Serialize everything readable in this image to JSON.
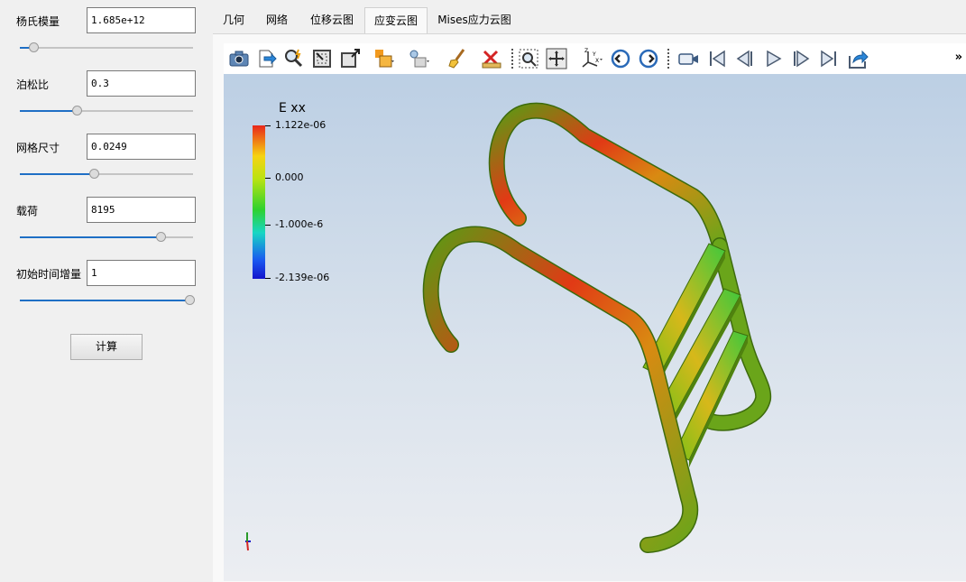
{
  "params": [
    {
      "label": "杨氏模量",
      "value": "1.685e+12",
      "slider": 0.07
    },
    {
      "label": "泊松比",
      "value": "0.3",
      "slider": 0.33
    },
    {
      "label": "网格尺寸",
      "value": "0.0249",
      "slider": 0.43
    },
    {
      "label": "载荷",
      "value": "8195",
      "slider": 0.83
    },
    {
      "label": "初始时间增量",
      "value": "1",
      "slider": 1.0
    }
  ],
  "compute_label": "计算",
  "tabs": [
    {
      "label": "几何",
      "active": false
    },
    {
      "label": "网络",
      "active": false
    },
    {
      "label": "位移云图",
      "active": false
    },
    {
      "label": "应变云图",
      "active": true
    },
    {
      "label": "Mises应力云图",
      "active": false
    }
  ],
  "toolbar": {
    "icons": [
      "camera-icon",
      "export-icon",
      "probe-icon",
      "select-cells-icon",
      "select-points-icon",
      "representation-icon",
      "light-kit-icon",
      "clean-brush-icon",
      "ruler-icon",
      "zoom-box-icon",
      "reset-camera-icon",
      "axes-orientation-icon",
      "rotate-ccw-icon",
      "rotate-cw-icon",
      "record-icon",
      "first-frame-icon",
      "previous-frame-icon",
      "play-icon",
      "next-frame-icon",
      "last-frame-icon",
      "share-icon"
    ],
    "more": "»"
  },
  "legend": {
    "title": "E xx",
    "labels": [
      "1.122e-06",
      "0.000",
      "-1.000e-6",
      "-2.139e-06"
    ],
    "colors": [
      "#e8261b",
      "#f6d312",
      "#b9e312",
      "#2ed12f",
      "#17d6c4",
      "#1a58f0",
      "#1414cc"
    ]
  },
  "colors": {
    "accent": "#1f6fc5",
    "model_green": "#6aa51a",
    "model_red": "#e23a16"
  }
}
